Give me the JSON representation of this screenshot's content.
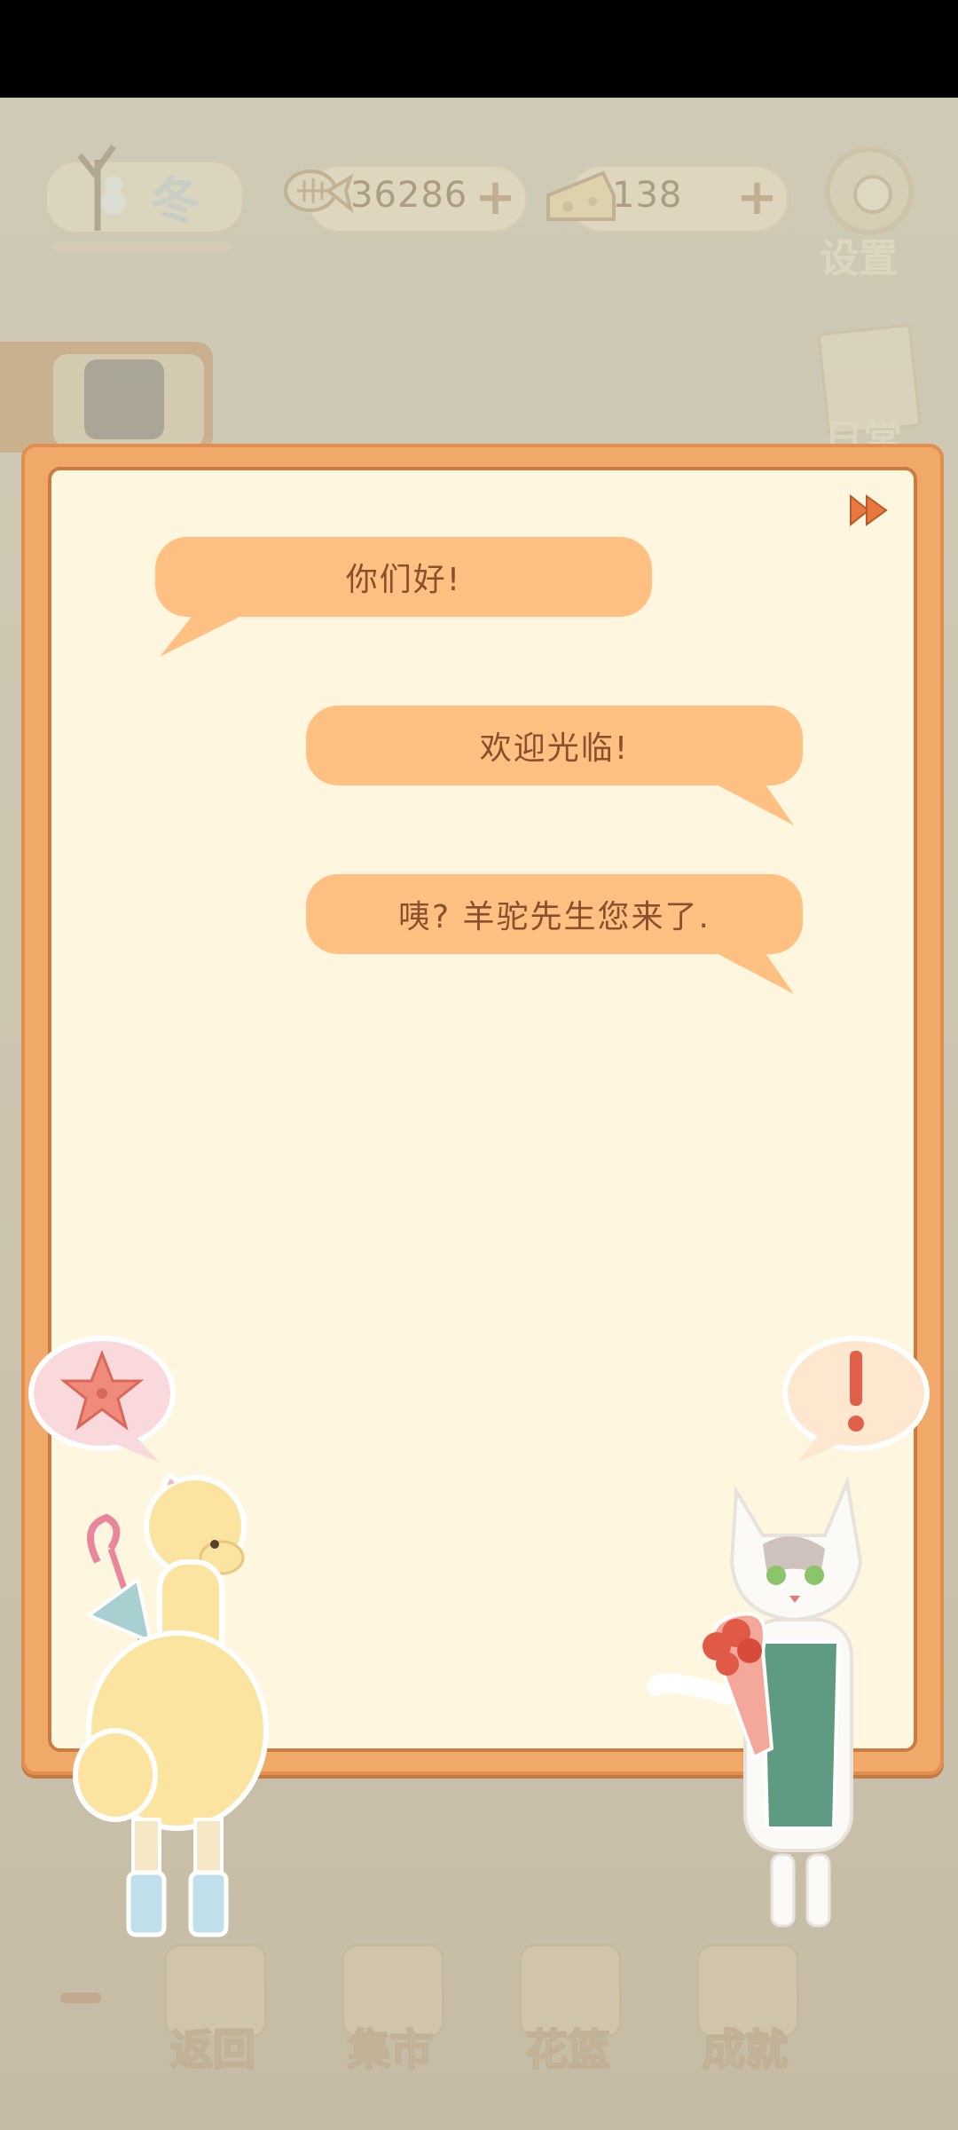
{
  "hud": {
    "season_label": "冬",
    "fish_count": "36286",
    "cheese_count": "138",
    "plus_symbol": "+",
    "settings_label": "设置",
    "daily_label": "日常"
  },
  "dialog": {
    "messages": [
      {
        "speaker": "alpaca",
        "text": "你们好!"
      },
      {
        "speaker": "cat",
        "text": "欢迎光临!"
      },
      {
        "speaker": "cat",
        "text": "咦? 羊驼先生您来了."
      }
    ]
  },
  "bottom_nav": {
    "items": [
      {
        "label": "返回"
      },
      {
        "label": "集市"
      },
      {
        "label": "花篮"
      },
      {
        "label": "成就"
      }
    ]
  },
  "colors": {
    "bubble": "#ffc082",
    "bubble_text": "#8a4f2c",
    "frame": "#f0a969",
    "paper": "#fff6df"
  }
}
